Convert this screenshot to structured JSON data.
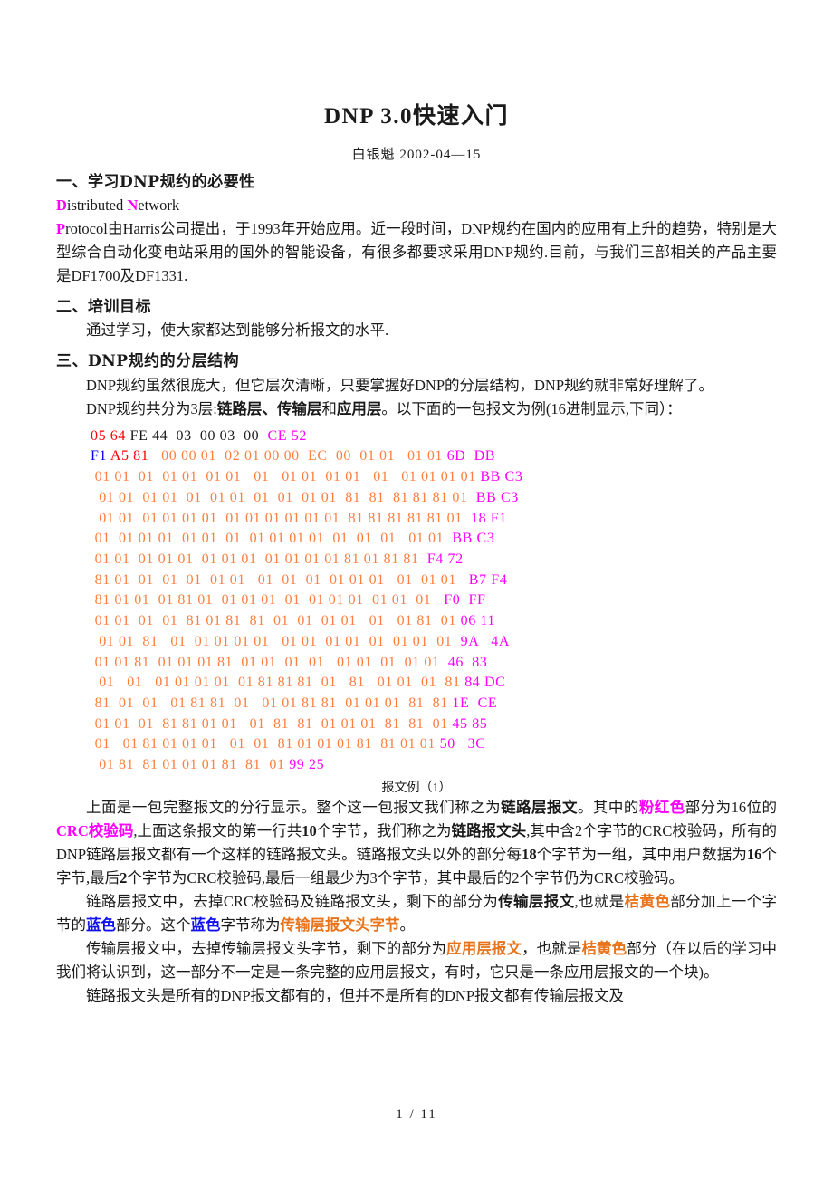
{
  "document": {
    "title": "DNP 3.0快速入门",
    "byline": "白银魁  2002-04—15",
    "footer": "1 / 11"
  },
  "sections": [
    {
      "heading": "一、学习DNP规约的必要性",
      "paragraphs": [
        {
          "runs": [
            {
              "text": "    ",
              "style": "plain"
            },
            {
              "text": "D",
              "style": "magenta"
            },
            {
              "text": "istributed ",
              "style": "plain"
            },
            {
              "text": "N",
              "style": "magenta"
            },
            {
              "text": "etwork",
              "style": "plain"
            }
          ]
        },
        {
          "runs": [
            {
              "text": "P",
              "style": "magenta"
            },
            {
              "text": "rotocol由Harris公司提出，于1993年开始应用。近一段时间，DNP规约在国内的应用有上升的趋势，特别是大型综合自动化变电站采用的国外的智能设备，有很多都要求采用DNP规约.目前，与我们三部相关的产品主要是DF1700及DF1331.",
              "style": "plain"
            }
          ]
        }
      ]
    },
    {
      "heading": "二、培训目标",
      "paragraphs": [
        {
          "indent": true,
          "runs": [
            {
              "text": "通过学习，使大家都达到能够分析报文的水平.",
              "style": "plain"
            }
          ]
        }
      ]
    },
    {
      "heading": "三、DNP规约的分层结构",
      "paragraphs": [
        {
          "indent": true,
          "runs": [
            {
              "text": "DNP规约虽然很庞大，但它层次清晰，只要掌握好DNP的分层结构，DNP规约就非常好理解了。",
              "style": "plain"
            }
          ]
        },
        {
          "indent": true,
          "runs": [
            {
              "text": "DNP规约共分为3层:",
              "style": "plain"
            },
            {
              "text": "链路层、传输层",
              "style": "bold"
            },
            {
              "text": "和",
              "style": "plain"
            },
            {
              "text": "应用层",
              "style": "bold"
            },
            {
              "text": "。以下面的一包报文为例(16进制显示,下同）：",
              "style": "plain"
            }
          ]
        }
      ]
    }
  ],
  "hex_dump": {
    "caption": "报文例（1）",
    "lines": [
      [
        {
          "text": "05 64 ",
          "color": "red"
        },
        {
          "text": "FE 44  03  00 03  00 ",
          "color": "black"
        },
        {
          "text": " CE 52",
          "color": "magenta"
        }
      ],
      [
        {
          "text": "F1 ",
          "color": "blue"
        },
        {
          "text": "A5 81 ",
          "color": "red"
        },
        {
          "text": "  00 00 01  02 01 00 00  EC  00  01 01   01 01 ",
          "color": "orange"
        },
        {
          "text": "6D  DB",
          "color": "magenta"
        }
      ],
      [
        {
          "text": " 01 01  01  01 01  01 01   01   01 01  01 01   01   01 01 01 01 ",
          "color": "orange"
        },
        {
          "text": "BB C3",
          "color": "magenta"
        }
      ],
      [
        {
          "text": "  01 01  01 01  01  01 01  01  01  01 01  81  81  81 81 81 01 ",
          "color": "orange"
        },
        {
          "text": " BB C3",
          "color": "magenta"
        }
      ],
      [
        {
          "text": "  01 01  01 01 01 01  01 01 01 01 01 01  81 81 81 81 81 01 ",
          "color": "orange"
        },
        {
          "text": " 18 F1",
          "color": "magenta"
        }
      ],
      [
        {
          "text": " 01  01 01 01  01 01  01  01 01 01 01  01  01  01   01 01 ",
          "color": "orange"
        },
        {
          "text": " BB C3",
          "color": "magenta"
        }
      ],
      [
        {
          "text": " 01 01  01 01 01  01 01 01  01 01 01 01 81 01 81 81 ",
          "color": "orange"
        },
        {
          "text": " F4 72",
          "color": "magenta"
        }
      ],
      [
        {
          "text": " 81 01  01  01  01  01 01   01  01  01  01 01 01   01  01 01 ",
          "color": "orange"
        },
        {
          "text": "  B7 F4",
          "color": "magenta"
        }
      ],
      [
        {
          "text": " 81 01 01  01 81 01  01 01 01  01  01 01 01  01 01  01  ",
          "color": "orange"
        },
        {
          "text": " F0  FF",
          "color": "magenta"
        }
      ],
      [
        {
          "text": " 01 01  01  01  81 01 81  81  01  01  01 01   01   01 81  01 ",
          "color": "orange"
        },
        {
          "text": "06 11",
          "color": "magenta"
        }
      ],
      [
        {
          "text": "  01 01  81   01  01 01 01 01   01 01  01 01  01  01 01  01  ",
          "color": "orange"
        },
        {
          "text": "9A   4A",
          "color": "magenta"
        }
      ],
      [
        {
          "text": " 01 01 81  01 01 01 81  01 01  01  01   01 01  01  01 01 ",
          "color": "orange"
        },
        {
          "text": " 46  83",
          "color": "magenta"
        }
      ],
      [
        {
          "text": "  01   01   01 01 01 01  01 81 81 81  01   81   01 01  01  81 ",
          "color": "orange"
        },
        {
          "text": "84 DC",
          "color": "magenta"
        }
      ],
      [
        {
          "text": " 81  01  01   01 81 81  01   01 01 81 81  01 01 01  81  81 ",
          "color": "orange"
        },
        {
          "text": "1E  CE",
          "color": "magenta"
        }
      ],
      [
        {
          "text": " 01 01  01  81 81 01 01   01  81  81  01 01 01  81  81  01 ",
          "color": "orange"
        },
        {
          "text": "45 85",
          "color": "magenta"
        }
      ],
      [
        {
          "text": " 01   01 81 01 01 01   01  01  81 01 01 01 81  81 01 01 ",
          "color": "orange"
        },
        {
          "text": "50   3C",
          "color": "magenta"
        }
      ],
      [
        {
          "text": "  01 81  81 01 01 01 81  81  01 ",
          "color": "orange"
        },
        {
          "text": "99 25",
          "color": "magenta"
        }
      ]
    ]
  },
  "explanations": [
    {
      "runs": [
        {
          "text": "上面是一包完整报文的分行显示。整个这一包报文我们称之为",
          "style": "plain"
        },
        {
          "text": "链路层报文",
          "style": "bold"
        },
        {
          "text": "。其中的",
          "style": "plain"
        },
        {
          "text": "粉红色",
          "style": "magenta"
        },
        {
          "text": "部分为16位的",
          "style": "plain"
        },
        {
          "text": "CRC校验码",
          "style": "magenta"
        },
        {
          "text": ",上面这条报文的第一行共",
          "style": "plain"
        },
        {
          "text": "10",
          "style": "bold"
        },
        {
          "text": "个字节，我们称之为",
          "style": "plain"
        },
        {
          "text": "链路报文头",
          "style": "bold"
        },
        {
          "text": ",其中含2个字节的CRC校验码，所有的DNP链路层报文都有一个这样的链路报文头。链路报文头以外的部分每",
          "style": "plain"
        },
        {
          "text": "18",
          "style": "bold"
        },
        {
          "text": "个字节为一组，其中用户数据为",
          "style": "plain"
        },
        {
          "text": "16",
          "style": "bold"
        },
        {
          "text": "个字节,最后",
          "style": "plain"
        },
        {
          "text": "2",
          "style": "bold"
        },
        {
          "text": "个字节为CRC校验码,最后一组最少为3个字节，其中最后的2个字节仍为CRC校验码。",
          "style": "plain"
        }
      ]
    },
    {
      "runs": [
        {
          "text": "链路层报文中，去掉CRC校验码及链路报文头，剩下的部分为",
          "style": "plain"
        },
        {
          "text": "传输层报文",
          "style": "bold"
        },
        {
          "text": ",也就是",
          "style": "plain"
        },
        {
          "text": "桔黄色",
          "style": "orange"
        },
        {
          "text": "部分加上一个字节的",
          "style": "plain"
        },
        {
          "text": "蓝色",
          "style": "blue"
        },
        {
          "text": "部分。这个",
          "style": "plain"
        },
        {
          "text": "蓝色",
          "style": "blue"
        },
        {
          "text": "字节称为",
          "style": "plain"
        },
        {
          "text": "传输层报文头字节",
          "style": "orange"
        },
        {
          "text": "。",
          "style": "plain"
        }
      ]
    },
    {
      "runs": [
        {
          "text": "传输层报文中，去掉传输层报文头字节，剩下的部分为",
          "style": "plain"
        },
        {
          "text": "应用层报文",
          "style": "orange"
        },
        {
          "text": "，也就是",
          "style": "plain"
        },
        {
          "text": "桔黄色",
          "style": "orange"
        },
        {
          "text": "部分（在以后的学习中我们将认识到，这一部分不一定是一条完整的应用层报文，有时，它只是一条应用层报文的一个块)。",
          "style": "plain"
        }
      ]
    },
    {
      "runs": [
        {
          "text": "链路报文头是所有的DNP报文都有的，但并不是所有的DNP报文都有传输层报文及",
          "style": "plain"
        }
      ]
    }
  ],
  "colors": {
    "red": "#ff0000",
    "black": "#1a1a1a",
    "magenta": "#ff00ff",
    "blue": "#0000ff",
    "orange": "#ff7f3f"
  }
}
